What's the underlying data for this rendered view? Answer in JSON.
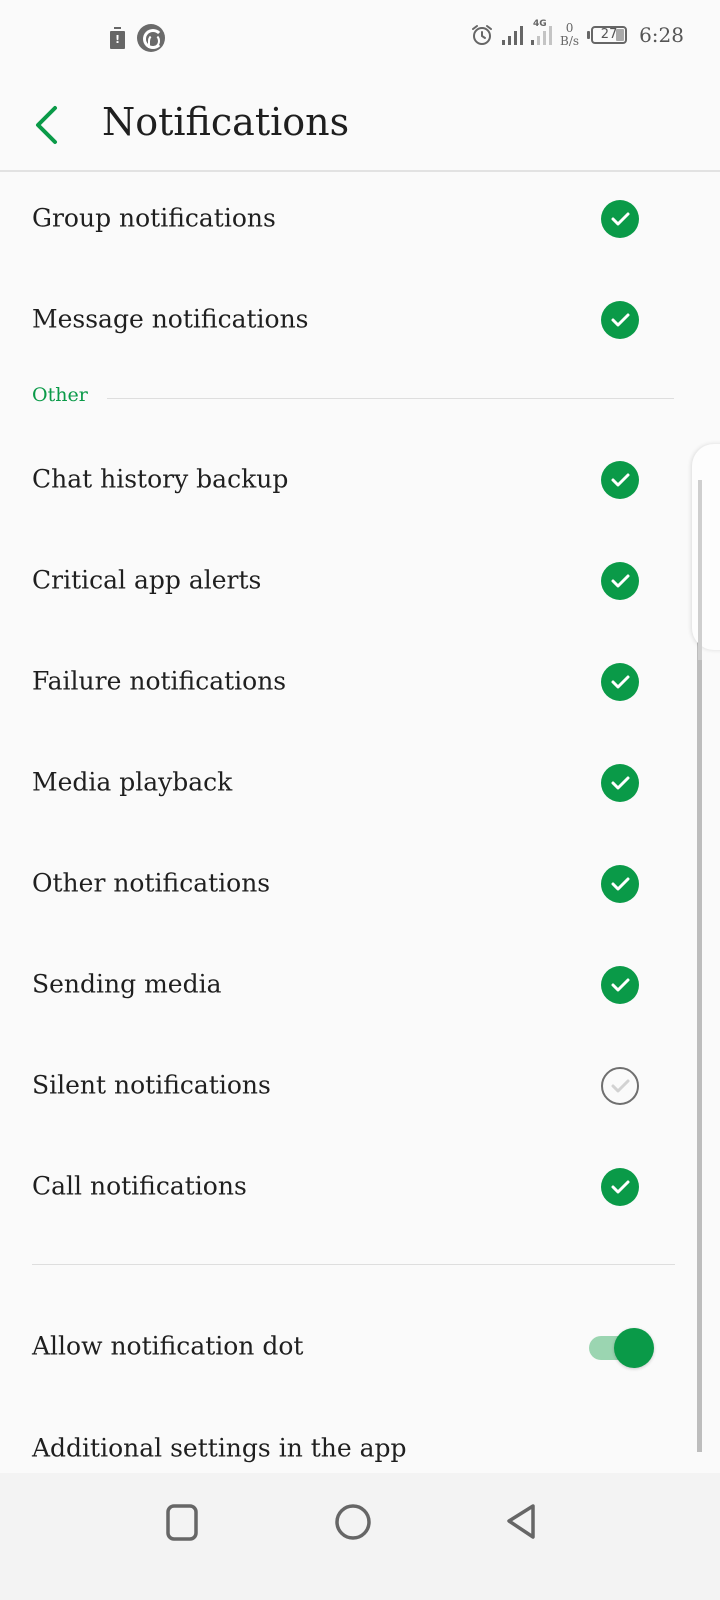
{
  "status_bar": {
    "left_icons": [
      "battery-warning-icon",
      "app-logo-icon"
    ],
    "battery_warning_glyph": "!",
    "network_type": "4G",
    "net_speed_value": "0",
    "net_speed_unit": "B/s",
    "battery_level": "27",
    "time": "6:28"
  },
  "header": {
    "back_icon": "chevron-left-icon",
    "title": "Notifications"
  },
  "accent_color": "#0a9a48",
  "items_top": [
    {
      "label": "Group notifications",
      "checked": true
    },
    {
      "label": "Message notifications",
      "checked": true
    }
  ],
  "section_other": {
    "title": "Other",
    "items": [
      {
        "label": "Chat history backup",
        "checked": true
      },
      {
        "label": "Critical app alerts",
        "checked": true
      },
      {
        "label": "Failure notifications",
        "checked": true
      },
      {
        "label": "Media playback",
        "checked": true
      },
      {
        "label": "Other notifications",
        "checked": true
      },
      {
        "label": "Sending media",
        "checked": true
      },
      {
        "label": "Silent notifications",
        "checked": false
      },
      {
        "label": "Call notifications",
        "checked": true
      }
    ]
  },
  "settings": {
    "notification_dot": {
      "label": "Allow notification dot",
      "enabled": true
    },
    "additional": {
      "label": "Additional settings in the app"
    }
  },
  "nav_bar": {
    "buttons": [
      "recents-icon",
      "home-icon",
      "back-icon"
    ]
  }
}
